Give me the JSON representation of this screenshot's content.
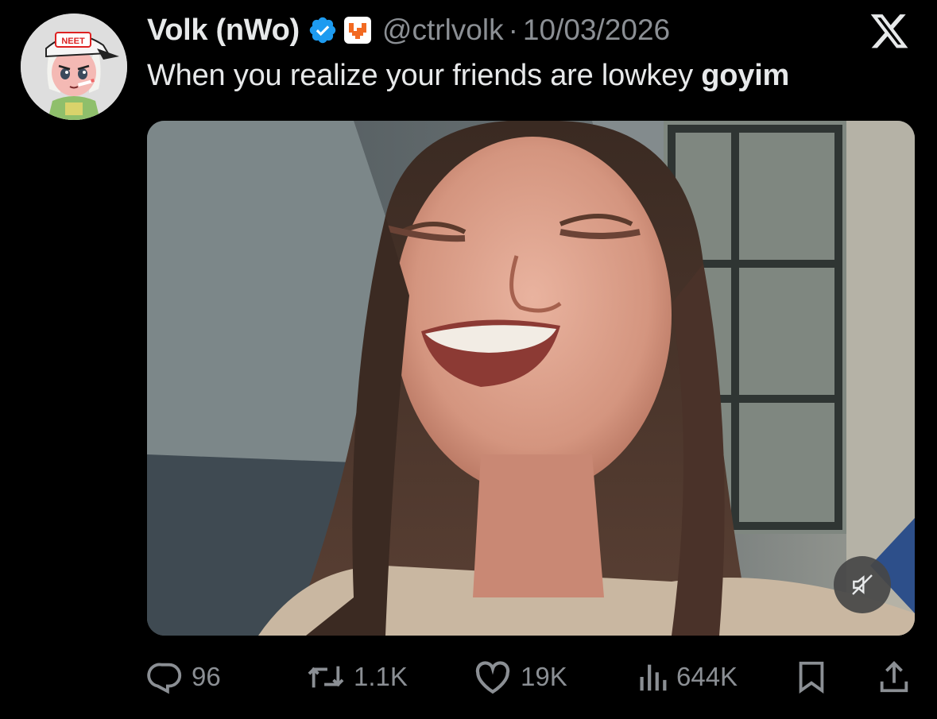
{
  "author": {
    "display_name": "Volk (nWo)",
    "handle": "@ctrlvolk",
    "separator": "·",
    "date": "10/03/2026",
    "verified_icon": "verified-badge-icon",
    "affiliate_icon": "affiliate-badge-icon",
    "avatar_badge_text": "NEET"
  },
  "tweet": {
    "text_plain": "When you realize your friends are lowkey ",
    "text_bold": "goyim"
  },
  "media": {
    "type": "video",
    "mute_icon": "muted-speaker-icon"
  },
  "actions": {
    "replies": "96",
    "reposts": "1.1K",
    "likes": "19K",
    "views": "644K",
    "reply_icon": "reply-icon",
    "repost_icon": "repost-icon",
    "like_icon": "heart-icon",
    "views_icon": "views-icon",
    "bookmark_icon": "bookmark-icon",
    "share_icon": "share-icon"
  },
  "colors": {
    "background": "#000000",
    "text_primary": "#e7e9ea",
    "text_secondary": "#8b8f94",
    "verified_blue": "#1d9bf0",
    "affiliate_orange": "#f26a22"
  }
}
